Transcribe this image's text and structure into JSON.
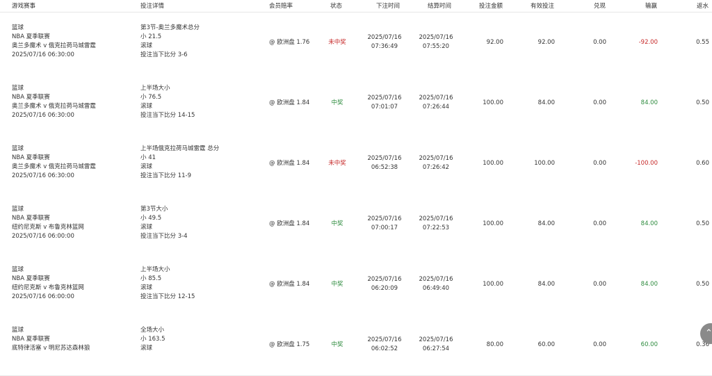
{
  "headers": {
    "game": "游戏赛事",
    "detail": "投注详情",
    "odds": "会员赔率",
    "status": "状态",
    "bet_time": "下注时间",
    "settle_time": "结算时间",
    "amount": "投注金额",
    "valid": "有效投注",
    "cashout": "兑现",
    "winloss": "输赢",
    "rebate": "返水"
  },
  "rows": [
    {
      "game": [
        "篮球",
        "NBA 夏季联赛",
        "奥兰多魔术 v 俄克拉荷马城雷霆",
        "2025/07/16 06:30:00"
      ],
      "detail": [
        "第3节-奥兰多魔术总分",
        "小 21.5",
        "滚球",
        "投注当下比分 3-6"
      ],
      "odds": "@ 欧洲盘 1.76",
      "status": "未中奖",
      "status_type": "lose",
      "bet_date": "2025/07/16",
      "bet_clock": "07:36:49",
      "settle_date": "2025/07/16",
      "settle_clock": "07:55:20",
      "amount": "92.00",
      "valid": "92.00",
      "cashout": "0.00",
      "winloss": "-92.00",
      "winloss_type": "lose",
      "rebate": "0.55"
    },
    {
      "game": [
        "篮球",
        "NBA 夏季联赛",
        "奥兰多魔术 v 俄克拉荷马城雷霆",
        "2025/07/16 06:30:00"
      ],
      "detail": [
        "上半场大小",
        "小 76.5",
        "滚球",
        "投注当下比分 14-15"
      ],
      "odds": "@ 欧洲盘 1.84",
      "status": "中奖",
      "status_type": "win",
      "bet_date": "2025/07/16",
      "bet_clock": "07:01:07",
      "settle_date": "2025/07/16",
      "settle_clock": "07:26:44",
      "amount": "100.00",
      "valid": "84.00",
      "cashout": "0.00",
      "winloss": "84.00",
      "winloss_type": "win",
      "rebate": "0.50"
    },
    {
      "game": [
        "篮球",
        "NBA 夏季联赛",
        "奥兰多魔术 v 俄克拉荷马城雷霆",
        "2025/07/16 06:30:00"
      ],
      "detail": [
        "上半场俄克拉荷马城雷霆 总分",
        "小 41",
        "滚球",
        "投注当下比分 11-9"
      ],
      "odds": "@ 欧洲盘 1.84",
      "status": "未中奖",
      "status_type": "lose",
      "bet_date": "2025/07/16",
      "bet_clock": "06:52:38",
      "settle_date": "2025/07/16",
      "settle_clock": "07:26:42",
      "amount": "100.00",
      "valid": "100.00",
      "cashout": "0.00",
      "winloss": "-100.00",
      "winloss_type": "lose",
      "rebate": "0.60"
    },
    {
      "game": [
        "篮球",
        "NBA 夏季联赛",
        "纽约尼克斯 v 布鲁克林篮网",
        "2025/07/16 06:00:00"
      ],
      "detail": [
        "第3节大小",
        "小 49.5",
        "滚球",
        "投注当下比分 3-4"
      ],
      "odds": "@ 欧洲盘 1.84",
      "status": "中奖",
      "status_type": "win",
      "bet_date": "2025/07/16",
      "bet_clock": "07:00:17",
      "settle_date": "2025/07/16",
      "settle_clock": "07:22:53",
      "amount": "100.00",
      "valid": "84.00",
      "cashout": "0.00",
      "winloss": "84.00",
      "winloss_type": "win",
      "rebate": "0.50"
    },
    {
      "game": [
        "篮球",
        "NBA 夏季联赛",
        "纽约尼克斯 v 布鲁克林篮网",
        "2025/07/16 06:00:00"
      ],
      "detail": [
        "上半场大小",
        "小 85.5",
        "滚球",
        "投注当下比分 12-15"
      ],
      "odds": "@ 欧洲盘 1.84",
      "status": "中奖",
      "status_type": "win",
      "bet_date": "2025/07/16",
      "bet_clock": "06:20:09",
      "settle_date": "2025/07/16",
      "settle_clock": "06:49:40",
      "amount": "100.00",
      "valid": "84.00",
      "cashout": "0.00",
      "winloss": "84.00",
      "winloss_type": "win",
      "rebate": "0.50"
    },
    {
      "game": [
        "篮球",
        "NBA 夏季联赛",
        "底特律活塞 v 明尼苏达森林狼",
        ""
      ],
      "detail": [
        "全场大小",
        "小 163.5",
        "滚球",
        ""
      ],
      "odds": "@ 欧洲盘 1.75",
      "status": "中奖",
      "status_type": "win",
      "bet_date": "2025/07/16",
      "bet_clock": "06:02:52",
      "settle_date": "2025/07/16",
      "settle_clock": "06:27:54",
      "amount": "80.00",
      "valid": "60.00",
      "cashout": "0.00",
      "winloss": "60.00",
      "winloss_type": "win",
      "rebate": "0.36"
    }
  ],
  "scroll_top_icon": "arrow-up-icon",
  "scroll_top_glyph": "⌃"
}
